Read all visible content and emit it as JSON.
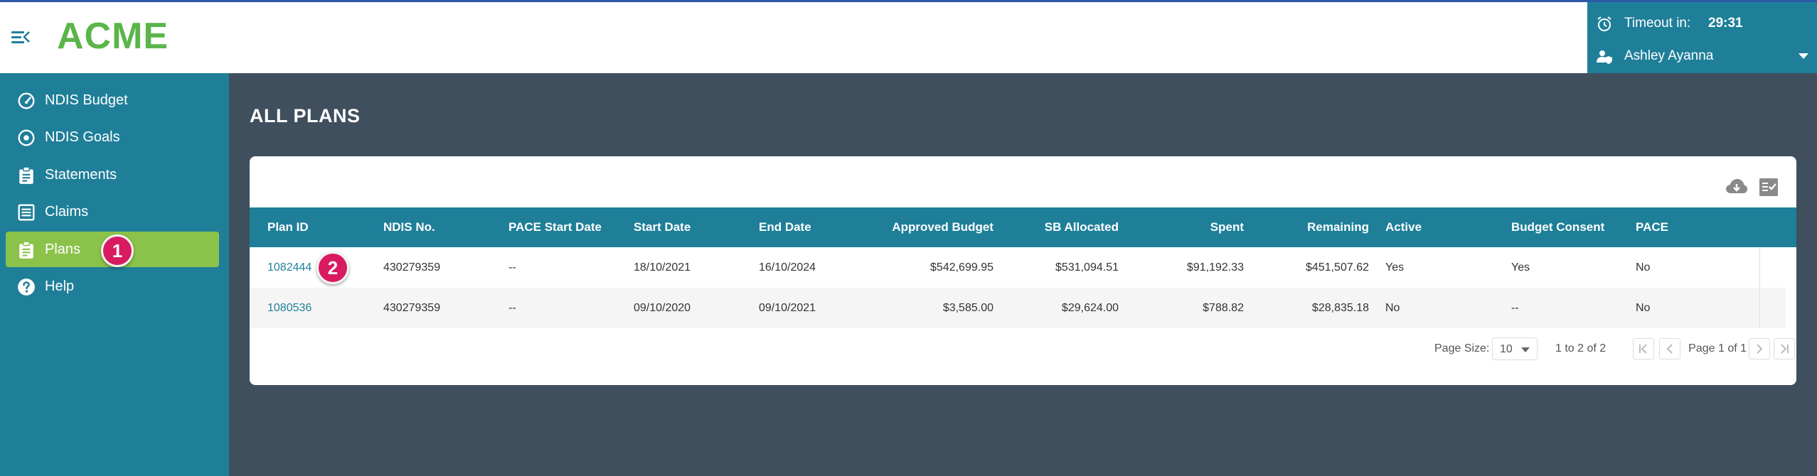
{
  "app": {
    "logo": "ACME"
  },
  "session": {
    "timeout_label": "Timeout in:",
    "timeout_value": "29:31",
    "user_name": "Ashley Ayanna"
  },
  "sidebar": {
    "items": [
      {
        "label": "NDIS Budget",
        "icon": "speedometer-icon"
      },
      {
        "label": "NDIS Goals",
        "icon": "target-icon"
      },
      {
        "label": "Statements",
        "icon": "clipboard-icon"
      },
      {
        "label": "Claims",
        "icon": "list-icon"
      },
      {
        "label": "Plans",
        "icon": "clipboard-check-icon",
        "active": true
      },
      {
        "label": "Help",
        "icon": "help-icon"
      }
    ]
  },
  "markers": {
    "first": "1",
    "second": "2"
  },
  "page": {
    "title": "ALL PLANS"
  },
  "table": {
    "columns": [
      "Plan ID",
      "NDIS No.",
      "PACE Start Date",
      "Start Date",
      "End Date",
      "Approved Budget",
      "SB Allocated",
      "Spent",
      "Remaining",
      "Active",
      "Budget Consent",
      "PACE"
    ],
    "rows": [
      [
        "1082444",
        "430279359",
        "--",
        "18/10/2021",
        "16/10/2024",
        "$542,699.95",
        "$531,094.51",
        "$91,192.33",
        "$451,507.62",
        "Yes",
        "Yes",
        "No"
      ],
      [
        "1080536",
        "430279359",
        "--",
        "09/10/2020",
        "09/10/2021",
        "$3,585.00",
        "$29,624.00",
        "$788.82",
        "$28,835.18",
        "No",
        "--",
        "No"
      ]
    ]
  },
  "pager": {
    "page_size_label": "Page Size:",
    "page_size": "10",
    "range": "1 to 2 of 2",
    "page_text": "Page 1 of 1"
  },
  "colors": {
    "primary": "#1f7f99",
    "accent": "#8bc34a",
    "logo": "#5bb54a",
    "background": "#3f4f5e",
    "marker": "#d81b60"
  }
}
